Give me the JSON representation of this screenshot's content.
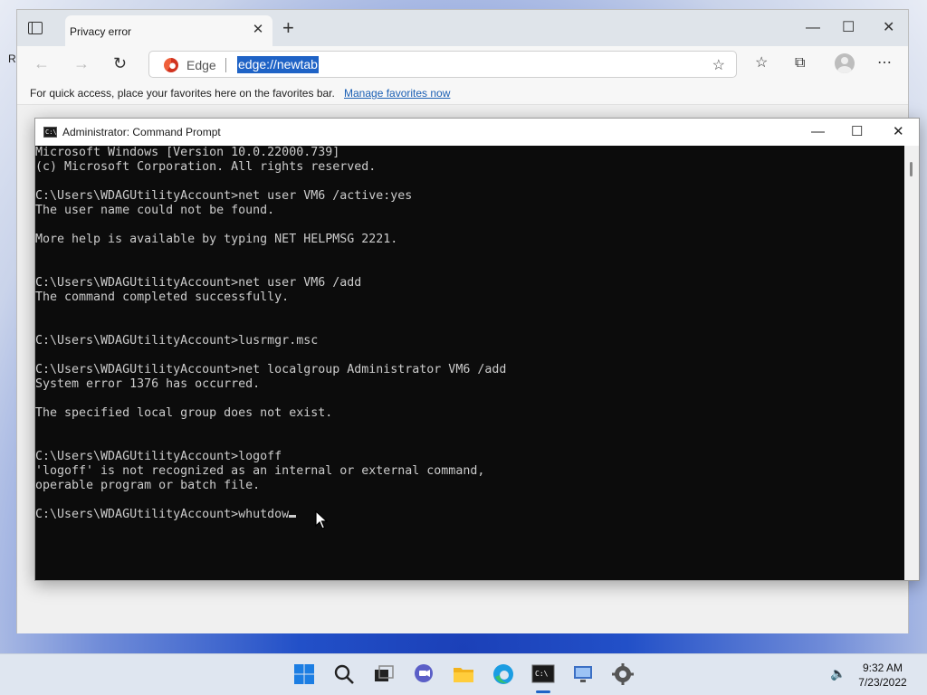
{
  "desktop": {
    "edge_letter": "R"
  },
  "edge": {
    "tab_title": "Privacy error",
    "omnibox_brand": "Edge",
    "url": "edge://newtab",
    "favorites_bar_message": "For quick access, place your favorites here on the favorites bar.",
    "favorites_bar_link": "Manage favorites now"
  },
  "cmd": {
    "title": "Administrator: Command Prompt",
    "lines": [
      "Microsoft Windows [Version 10.0.22000.739]",
      "(c) Microsoft Corporation. All rights reserved.",
      "",
      "C:\\Users\\WDAGUtilityAccount>net user VM6 /active:yes",
      "The user name could not be found.",
      "",
      "More help is available by typing NET HELPMSG 2221.",
      "",
      "",
      "C:\\Users\\WDAGUtilityAccount>net user VM6 /add",
      "The command completed successfully.",
      "",
      "",
      "C:\\Users\\WDAGUtilityAccount>lusrmgr.msc",
      "",
      "C:\\Users\\WDAGUtilityAccount>net localgroup Administrator VM6 /add",
      "System error 1376 has occurred.",
      "",
      "The specified local group does not exist.",
      "",
      "",
      "C:\\Users\\WDAGUtilityAccount>logoff",
      "'logoff' is not recognized as an internal or external command,",
      "operable program or batch file.",
      ""
    ],
    "input_line": "C:\\Users\\WDAGUtilityAccount>whutdow"
  },
  "taskbar": {
    "apps": [
      "windows-start-icon",
      "search-icon",
      "task-view-icon",
      "chat-icon",
      "file-explorer-icon",
      "edge-icon",
      "command-prompt-icon",
      "remote-desktop-icon",
      "settings-icon"
    ],
    "time": "9:32 AM",
    "date": "7/23/2022"
  },
  "colors": {
    "accent": "#1f63c6",
    "console_bg": "#0c0c0c",
    "console_fg": "#cccccc"
  }
}
